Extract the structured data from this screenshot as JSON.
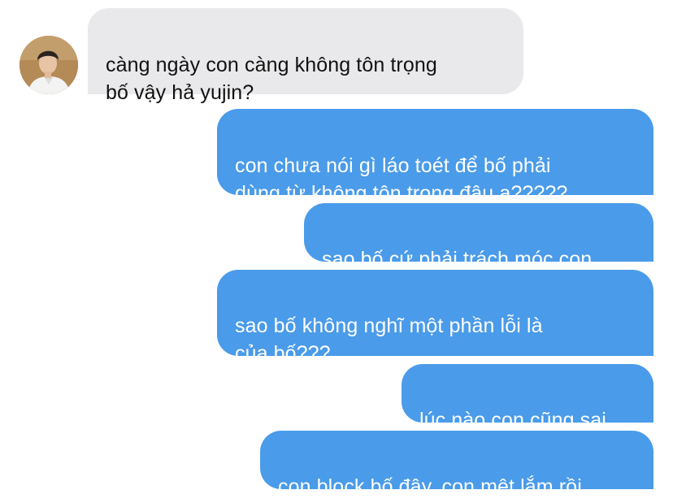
{
  "conversation": {
    "contact": {
      "avatar_icon": "profile-photo-icon"
    },
    "messages": [
      {
        "direction": "incoming",
        "text": "càng ngày con càng không tôn trọng\nbố vậy hả yujin?"
      },
      {
        "direction": "outgoing",
        "text": "con chưa nói gì láo toét để bố phải\ndùng từ không tôn trọng đâu ạ?????"
      },
      {
        "direction": "outgoing",
        "text": "sao bố cứ phải trách móc con"
      },
      {
        "direction": "outgoing",
        "text": "sao bố không nghĩ một phần lỗi là\ncủa bố???"
      },
      {
        "direction": "outgoing",
        "text": "lúc nào con cũng sai"
      },
      {
        "direction": "outgoing",
        "text": "con block bố đây, con mệt lắm rồi"
      }
    ]
  },
  "colors": {
    "incoming_bubble": "#e9e9eb",
    "outgoing_bubble": "#4a9be9",
    "incoming_text": "#111111",
    "outgoing_text": "#ffffff",
    "background": "#ffffff"
  }
}
